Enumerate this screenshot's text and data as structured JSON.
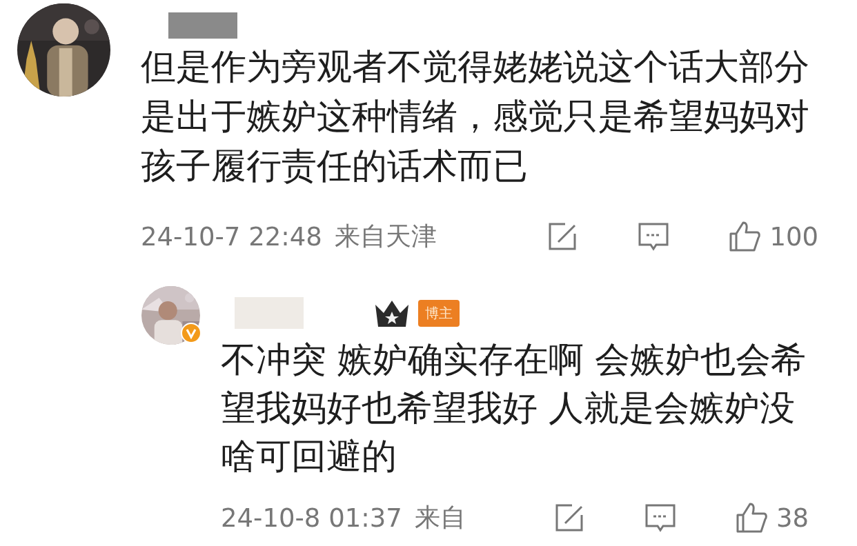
{
  "comments": [
    {
      "kind": "comment",
      "text": "但是作为旁观者不觉得姥姥说这个话大部分是出于嫉妒这种情绪，感觉只是希望妈妈对孩子履行责任的话术而已",
      "time": "24-10-7 22:48",
      "location": "来自天津",
      "likes": "100",
      "verified": false
    },
    {
      "kind": "reply",
      "text": "不冲突 嫉妒确实存在啊 会嫉妒也会希望我妈好也希望我好 人就是会嫉妒没啥可回避的",
      "time": "24-10-8 01:37",
      "location": "来自",
      "likes": "38",
      "verified": true,
      "badge": "博主"
    }
  ]
}
